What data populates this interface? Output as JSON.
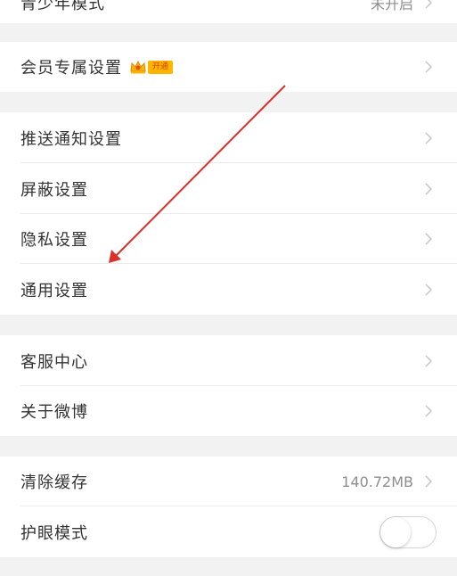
{
  "colors": {
    "page_background": "#f2f2f2",
    "row_background": "#ffffff",
    "label_text": "#333333",
    "value_text": "#8e8e8e",
    "arrow": "#d9302a",
    "vip_tag": "#ffb400"
  },
  "top_row": {
    "label": "青少年模式",
    "value": "未开启"
  },
  "vip_row": {
    "label": "会员专属设置",
    "badge_text": "开通"
  },
  "group_notifications": {
    "items": [
      {
        "label": "推送通知设置"
      },
      {
        "label": "屏蔽设置"
      },
      {
        "label": "隐私设置"
      },
      {
        "label": "通用设置"
      }
    ]
  },
  "group_about": {
    "items": [
      {
        "label": "客服中心"
      },
      {
        "label": "关于微博"
      }
    ]
  },
  "cache_row": {
    "label": "清除缓存",
    "value": "140.72MB"
  },
  "eye_row": {
    "label": "护眼模式",
    "enabled": false
  },
  "icons": {
    "chevron": "chevron-right-icon",
    "crown": "crown-icon",
    "arrow": "red-arrow-annotation"
  }
}
